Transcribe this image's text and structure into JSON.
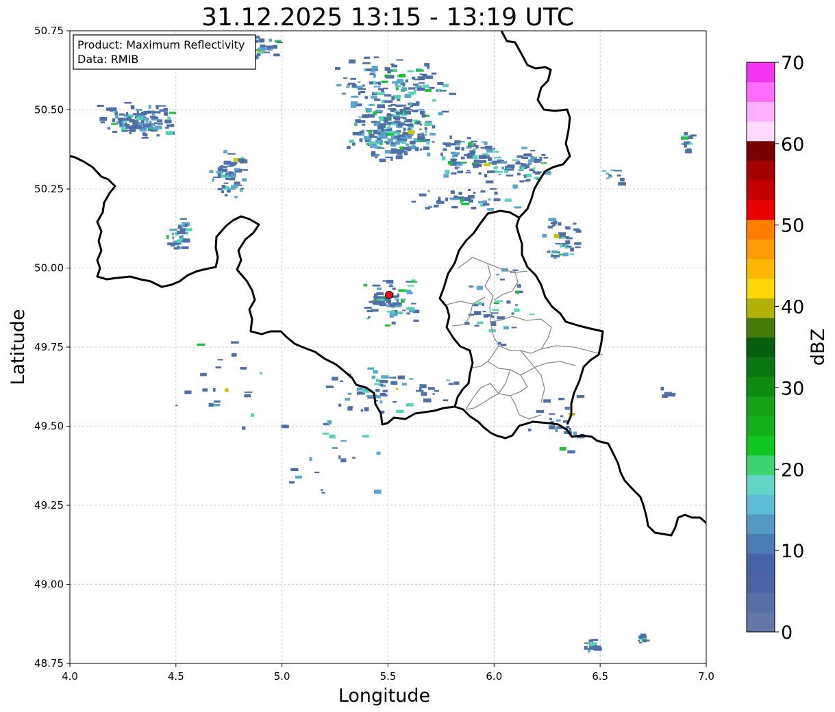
{
  "title": "31.12.2025 13:15 - 13:19 UTC",
  "info_box": {
    "product_line": "Product: Maximum Reflectivity",
    "data_line": "Data: RMIB"
  },
  "x_axis": {
    "label": "Longitude",
    "range": [
      4.0,
      7.0
    ],
    "ticks": [
      "4.0",
      "4.5",
      "5.0",
      "5.5",
      "6.0",
      "6.5",
      "7.0"
    ]
  },
  "y_axis": {
    "label": "Latitude",
    "range": [
      48.75,
      50.75
    ],
    "ticks": [
      "48.75",
      "49.00",
      "49.25",
      "49.50",
      "49.75",
      "50.00",
      "50.25",
      "50.50",
      "50.75"
    ]
  },
  "grid": "dashed light gray",
  "radar_site": {
    "lon": 5.505,
    "lat": 49.915,
    "color": "#e8121e"
  },
  "colorbar": {
    "label": "dBZ",
    "range": [
      0,
      70
    ],
    "ticks": [
      "0",
      "10",
      "20",
      "30",
      "40",
      "50",
      "60",
      "70"
    ],
    "colors": [
      "#6577a6",
      "#5a6fa8",
      "#4c62a4",
      "#4563a6",
      "#4b7db4",
      "#5399c3",
      "#5fbcd6",
      "#62d6c4",
      "#3cd370",
      "#11c61e",
      "#13b21c",
      "#11a216",
      "#0d8c12",
      "#0a7610",
      "#065f0c",
      "#467a0a",
      "#b0b208",
      "#fad705",
      "#feb705",
      "#fe9a04",
      "#ff7e00",
      "#e80000",
      "#c40000",
      "#a60000",
      "#7a0000",
      "#ffdcff",
      "#ffb0ff",
      "#ff6cff",
      "#f135f0"
    ]
  },
  "reflectivity_colors": {
    "weak": "#4e6fa8",
    "light": "#5aa6cc",
    "moderate": "#55d2b8",
    "strong": "#1fbf3a",
    "heavy": "#c6c400"
  },
  "map_features": {
    "country_border_color": "#000000",
    "province_border_color": "#8a8a8a"
  }
}
